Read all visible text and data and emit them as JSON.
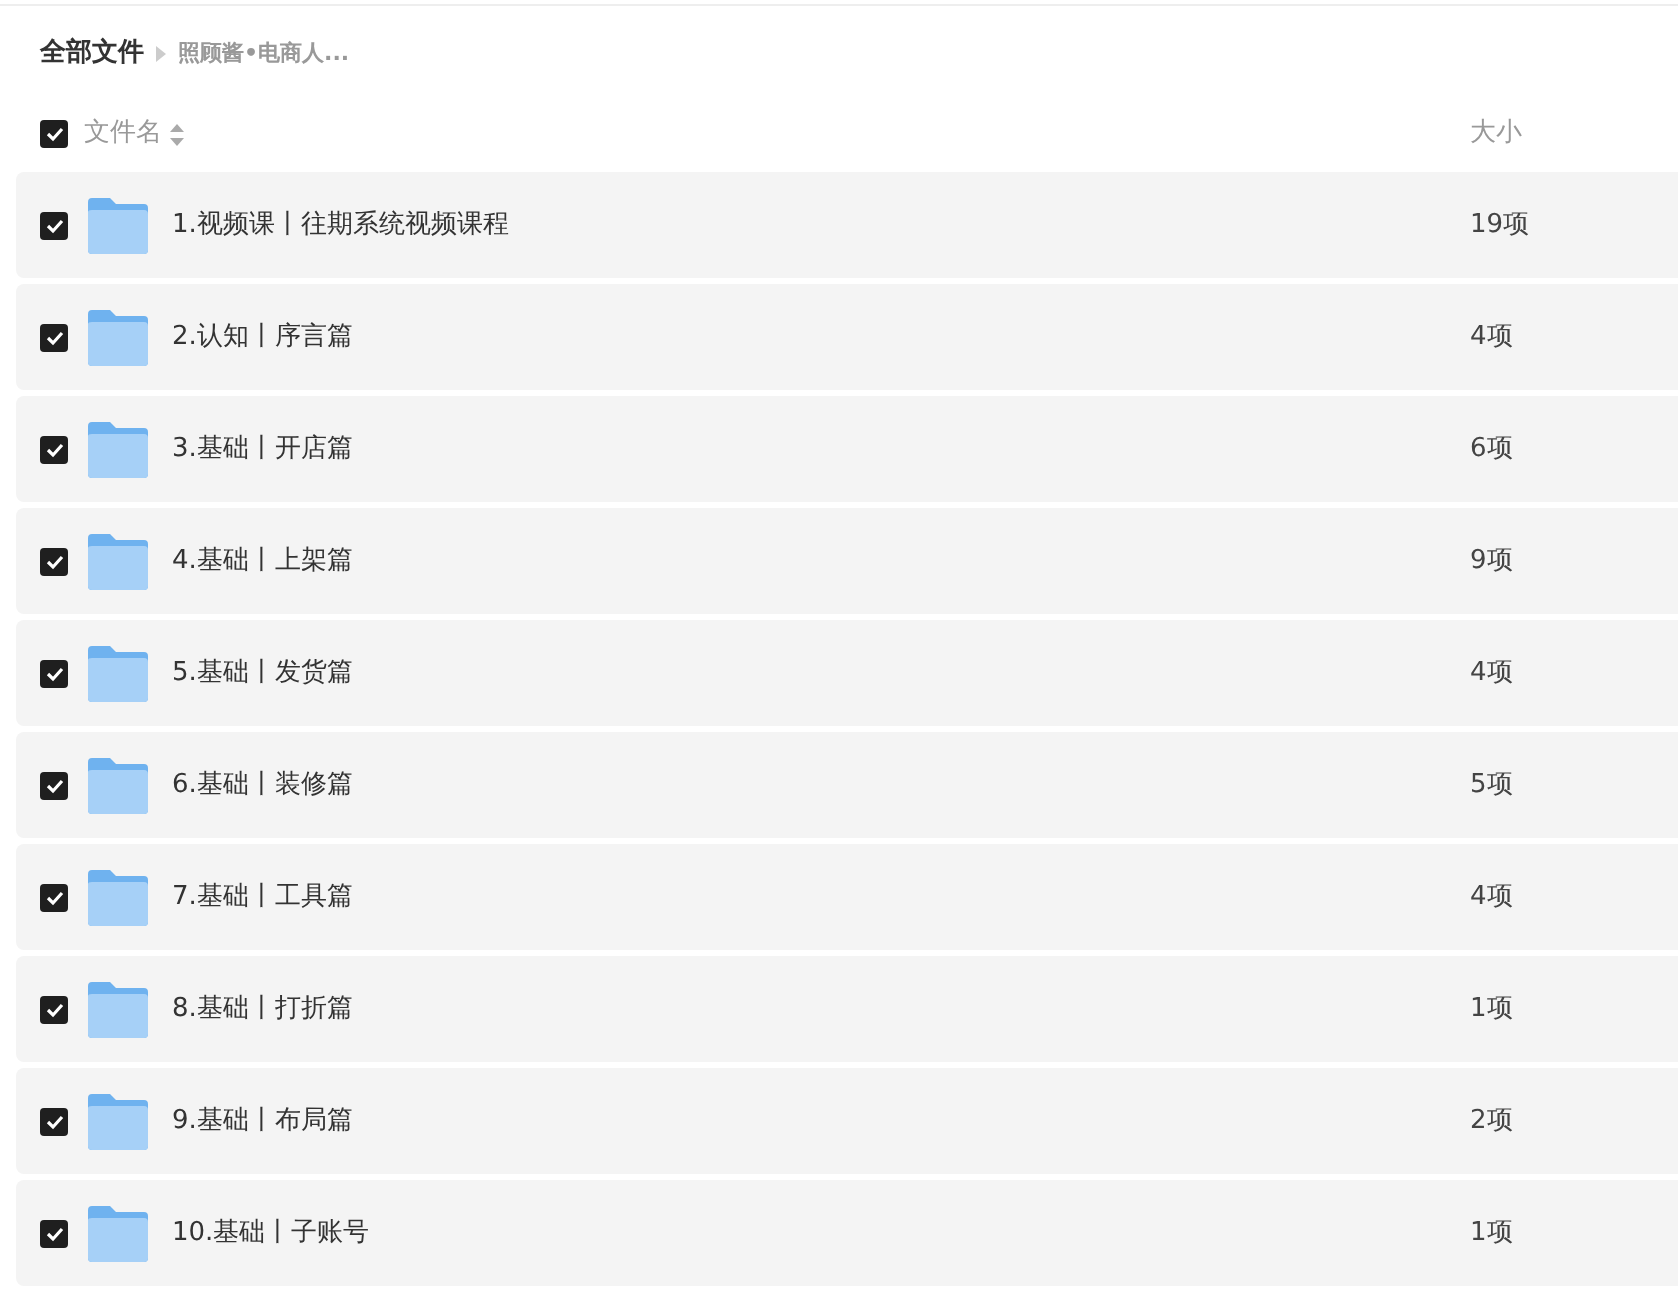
{
  "breadcrumb": {
    "root": "全部文件",
    "current": "照顾酱•电商人..."
  },
  "header": {
    "checked": true,
    "name": "文件名",
    "size": "大小"
  },
  "rows": [
    {
      "name": "1.视频课丨往期系统视频课程",
      "size": "19项",
      "checked": true
    },
    {
      "name": "2.认知丨序言篇",
      "size": "4项",
      "checked": true
    },
    {
      "name": "3.基础丨开店篇",
      "size": "6项",
      "checked": true
    },
    {
      "name": "4.基础丨上架篇",
      "size": "9项",
      "checked": true
    },
    {
      "name": "5.基础丨发货篇",
      "size": "4项",
      "checked": true
    },
    {
      "name": "6.基础丨装修篇",
      "size": "5项",
      "checked": true
    },
    {
      "name": "7.基础丨工具篇",
      "size": "4项",
      "checked": true
    },
    {
      "name": "8.基础丨打折篇",
      "size": "1项",
      "checked": true
    },
    {
      "name": "9.基础丨布局篇",
      "size": "2项",
      "checked": true
    },
    {
      "name": "10.基础丨子账号",
      "size": "1项",
      "checked": true
    }
  ]
}
